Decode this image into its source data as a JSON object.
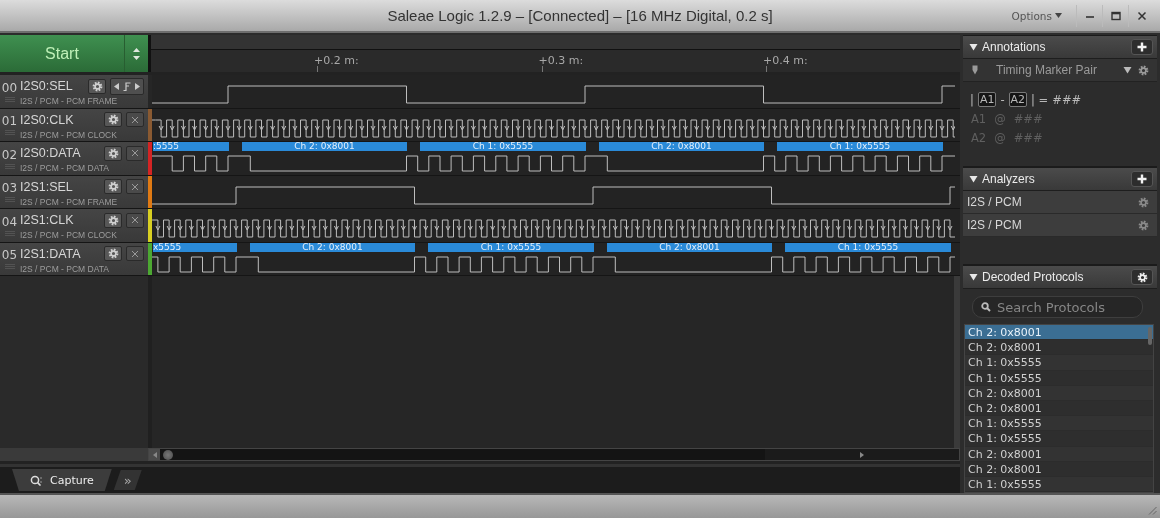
{
  "window": {
    "title": "Saleae Logic 1.2.9 – [Connected] – [16 MHz Digital, 0.2 s]",
    "options_menu": "Options"
  },
  "start_button": {
    "label": "Start"
  },
  "timeline": {
    "ticks": [
      "+0.2 m:",
      "+0.3 m:",
      "+0.4 m:"
    ]
  },
  "channels": [
    {
      "number": "00",
      "name": "I2S0:SEL",
      "analyzer": "I2S / PCM - PCM FRAME",
      "kind": "frame",
      "color": "#262626",
      "hovered": true
    },
    {
      "number": "01",
      "name": "I2S0:CLK",
      "analyzer": "I2S / PCM - PCM CLOCK",
      "kind": "clock",
      "color": "#8a5a32",
      "hovered": false
    },
    {
      "number": "02",
      "name": "I2S0:DATA",
      "analyzer": "I2S / PCM - PCM DATA",
      "kind": "data",
      "color": "#d42424",
      "hovered": false,
      "frames": [
        ":5555",
        "Ch 2: 0x8001",
        "Ch 1: 0x5555",
        "Ch 2: 0x8001",
        "Ch 1: 0x5555"
      ]
    },
    {
      "number": "03",
      "name": "I2S1:SEL",
      "analyzer": "I2S / PCM - PCM FRAME",
      "kind": "frame",
      "color": "#e07a14",
      "hovered": false
    },
    {
      "number": "04",
      "name": "I2S1:CLK",
      "analyzer": "I2S / PCM - PCM CLOCK",
      "kind": "clock",
      "color": "#d8cf22",
      "hovered": false
    },
    {
      "number": "05",
      "name": "I2S1:DATA",
      "analyzer": "I2S / PCM - PCM DATA",
      "kind": "data",
      "color": "#4ca832",
      "hovered": false,
      "frames": [
        "x5555",
        "Ch 2: 0x8001",
        "Ch 1: 0x5555",
        "Ch 2: 0x8001",
        "Ch 1: 0x5555"
      ]
    }
  ],
  "tabs": [
    {
      "label": "Capture",
      "selected": true
    }
  ],
  "tab_overflow": "»",
  "annotations": {
    "title": "Annotations",
    "marker": "Timing Marker Pair",
    "formula": [
      {
        "kind": "text",
        "text": "|"
      },
      {
        "kind": "marker",
        "text": "A1"
      },
      {
        "kind": "text",
        "text": "-"
      },
      {
        "kind": "marker",
        "text": "A2"
      },
      {
        "kind": "text",
        "text": "| ="
      },
      {
        "kind": "text",
        "text": "###"
      }
    ],
    "markers": [
      {
        "marker": "A1",
        "at": "@",
        "value": "###"
      },
      {
        "marker": "A2",
        "at": "@",
        "value": "###"
      }
    ]
  },
  "analyzers": {
    "title": "Analyzers",
    "items": [
      "I2S / PCM",
      "I2S / PCM"
    ]
  },
  "decoded_protocols": {
    "title": "Decoded Protocols",
    "placeholder": "Search Protocols",
    "rows": [
      {
        "text": "Ch 2: 0x8001",
        "selected": true
      },
      {
        "text": "Ch 2: 0x8001",
        "selected": false
      },
      {
        "text": "Ch 1: 0x5555",
        "selected": false
      },
      {
        "text": "Ch 1: 0x5555",
        "selected": false
      },
      {
        "text": "Ch 2: 0x8001",
        "selected": false
      },
      {
        "text": "Ch 2: 0x8001",
        "selected": false
      },
      {
        "text": "Ch 1: 0x5555",
        "selected": false
      },
      {
        "text": "Ch 1: 0x5555",
        "selected": false
      },
      {
        "text": "Ch 2: 0x8001",
        "selected": false
      },
      {
        "text": "Ch 2: 0x8001",
        "selected": false
      },
      {
        "text": "Ch 1: 0x5555",
        "selected": false
      }
    ]
  }
}
